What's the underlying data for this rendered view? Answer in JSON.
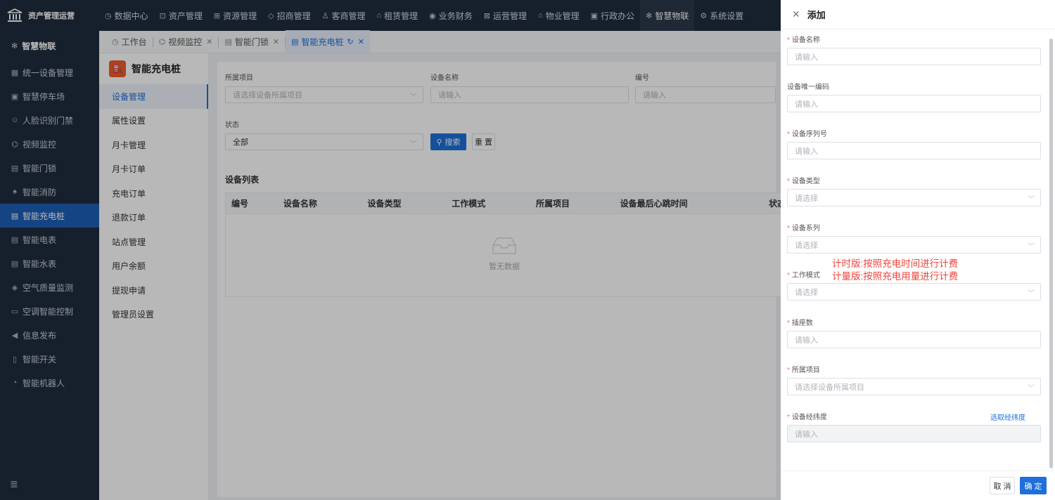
{
  "app": {
    "name": "资产管理运营"
  },
  "topnav": [
    {
      "icon": "◷",
      "label": "数据中心"
    },
    {
      "icon": "⊡",
      "label": "资产管理"
    },
    {
      "icon": "⊞",
      "label": "资源管理"
    },
    {
      "icon": "◇",
      "label": "招商管理"
    },
    {
      "icon": "♙",
      "label": "客商管理"
    },
    {
      "icon": "⌂",
      "label": "租赁管理"
    },
    {
      "icon": "◉",
      "label": "业务财务"
    },
    {
      "icon": "⊠",
      "label": "运营管理"
    },
    {
      "icon": "⌂",
      "label": "物业管理"
    },
    {
      "icon": "▣",
      "label": "行政办公"
    },
    {
      "icon": "✻",
      "label": "智慧物联"
    },
    {
      "icon": "⚙",
      "label": "系统设置"
    }
  ],
  "sidebar": {
    "head": {
      "icon": "✻",
      "label": "智慧物联"
    },
    "items": [
      {
        "icon": "▦",
        "label": "统一设备管理"
      },
      {
        "icon": "▣",
        "label": "智慧停车场"
      },
      {
        "icon": "☺",
        "label": "人脸识别门禁"
      },
      {
        "icon": "⌬",
        "label": "视频监控"
      },
      {
        "icon": "▤",
        "label": "智能门锁"
      },
      {
        "icon": "♠",
        "label": "智能消防"
      },
      {
        "icon": "▤",
        "label": "智能充电桩"
      },
      {
        "icon": "▤",
        "label": "智能电表"
      },
      {
        "icon": "▤",
        "label": "智能水表"
      },
      {
        "icon": "◈",
        "label": "空气质量监测"
      },
      {
        "icon": "▭",
        "label": "空调智能控制"
      },
      {
        "icon": "◀",
        "label": "信息发布"
      },
      {
        "icon": "▯",
        "label": "智能开关"
      },
      {
        "icon": "◔",
        "label": "智能机器人"
      }
    ],
    "collapse_icon": "≣"
  },
  "tabs": [
    {
      "icon": "◷",
      "label": "工作台",
      "closable": false
    },
    {
      "icon": "⌬",
      "label": "视频监控",
      "closable": true
    },
    {
      "icon": "▤",
      "label": "智能门锁",
      "closable": true
    },
    {
      "icon": "▤",
      "label": "智能充电桩",
      "closable": true,
      "refresh": "↻"
    }
  ],
  "submenu": {
    "title": "智能充电桩",
    "logo_icon": "⛽",
    "items": [
      "设备管理",
      "属性设置",
      "月卡管理",
      "月卡订单",
      "充电订单",
      "退款订单",
      "站点管理",
      "用户余额",
      "提现申请",
      "管理员设置"
    ]
  },
  "filters": {
    "project_label": "所属项目",
    "project_placeholder": "请选择设备所属项目",
    "name_label": "设备名称",
    "name_placeholder": "请输入",
    "code_label": "编号",
    "code_placeholder": "请输入",
    "status_label": "状态",
    "status_value": "全部",
    "search_label": "搜索",
    "reset_label": "重 置"
  },
  "device_list": {
    "title": "设备列表",
    "columns": [
      "编号",
      "设备名称",
      "设备类型",
      "工作模式",
      "所属项目",
      "设备最后心跳时间",
      "状态"
    ],
    "empty_text": "暂无数据"
  },
  "drawer": {
    "title": "添加",
    "fields": [
      {
        "label": "设备名称",
        "required": true,
        "placeholder": "请输入",
        "type": "input"
      },
      {
        "label": "设备唯一编码",
        "required": false,
        "placeholder": "请输入",
        "type": "input"
      },
      {
        "label": "设备序列号",
        "required": true,
        "placeholder": "请输入",
        "type": "input"
      },
      {
        "label": "设备类型",
        "required": true,
        "placeholder": "请选择",
        "type": "select"
      },
      {
        "label": "设备系列",
        "required": true,
        "placeholder": "请选择",
        "type": "select"
      },
      {
        "label": "工作模式",
        "required": true,
        "placeholder": "请选择",
        "type": "select"
      },
      {
        "label": "插座数",
        "required": true,
        "placeholder": "请输入",
        "type": "input"
      },
      {
        "label": "所属项目",
        "required": true,
        "placeholder": "请选择设备所属项目",
        "type": "select"
      },
      {
        "label": "设备经纬度",
        "required": true,
        "placeholder": "请输入",
        "type": "disabled"
      }
    ],
    "pick_coords_link": "选取经纬度",
    "work_mode_notes": [
      "计时版:按照充电时间进行计费",
      "计量版:按照充电用量进行计费"
    ],
    "cancel_label": "取 消",
    "confirm_label": "确 定"
  }
}
